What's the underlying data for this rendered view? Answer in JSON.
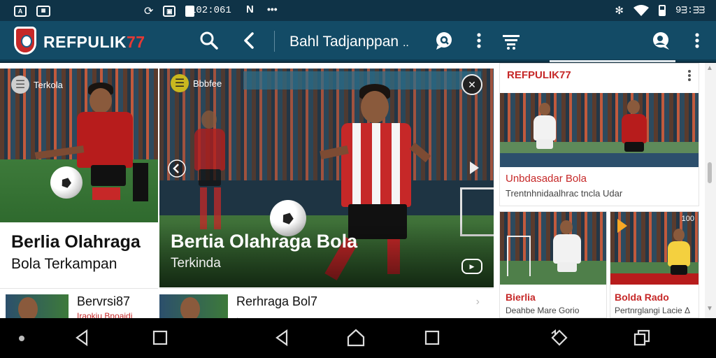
{
  "status_bar": {
    "left_badge": "A",
    "time": "102:061",
    "clock_right": "9ᴟ:ᴟᴟ"
  },
  "app_bar": {
    "brand_main": "REFPULIK",
    "brand_accent": "77",
    "title": "Bahl Tadjanppan",
    "title_suffix": "..",
    "icons": [
      "search-icon",
      "back-icon",
      "chat-icon",
      "more-vert-icon",
      "filter-icon",
      "profile-chat-icon",
      "more-vert-icon"
    ]
  },
  "cards": {
    "left_top": {
      "chip": "Terkola",
      "headline": "Berlia Olahraga",
      "subline": "Bola Terkampan"
    },
    "hero": {
      "chip": "Bbbfee",
      "headline": "Bertia Olahraga Bola",
      "subline": "Terkinda"
    },
    "right_top": {
      "brand": "REFPULIK77",
      "title": "Unbdasadar Bola",
      "subtitle": "Trentnhnidaalhrac tncla Udar"
    },
    "right_bottom_left": {
      "title": "Bierlia",
      "subtitle": "Deahbe Mare Gorio"
    },
    "right_bottom_right": {
      "badge": "100",
      "title": "Bolda Rado",
      "subtitle": "Pertnrglangi Lacie Δ"
    },
    "bottom_left": {
      "title": "Bervrsi87",
      "subtitle": "Iraokiu Bnoaidi"
    },
    "bottom_mid": {
      "title": "Rerhraga Bol7",
      "subtitle": ","
    }
  },
  "colors": {
    "app_bar": "#134b66",
    "status_bar": "#0f3347",
    "brand_red": "#c62828",
    "nav_bar": "#000000"
  }
}
